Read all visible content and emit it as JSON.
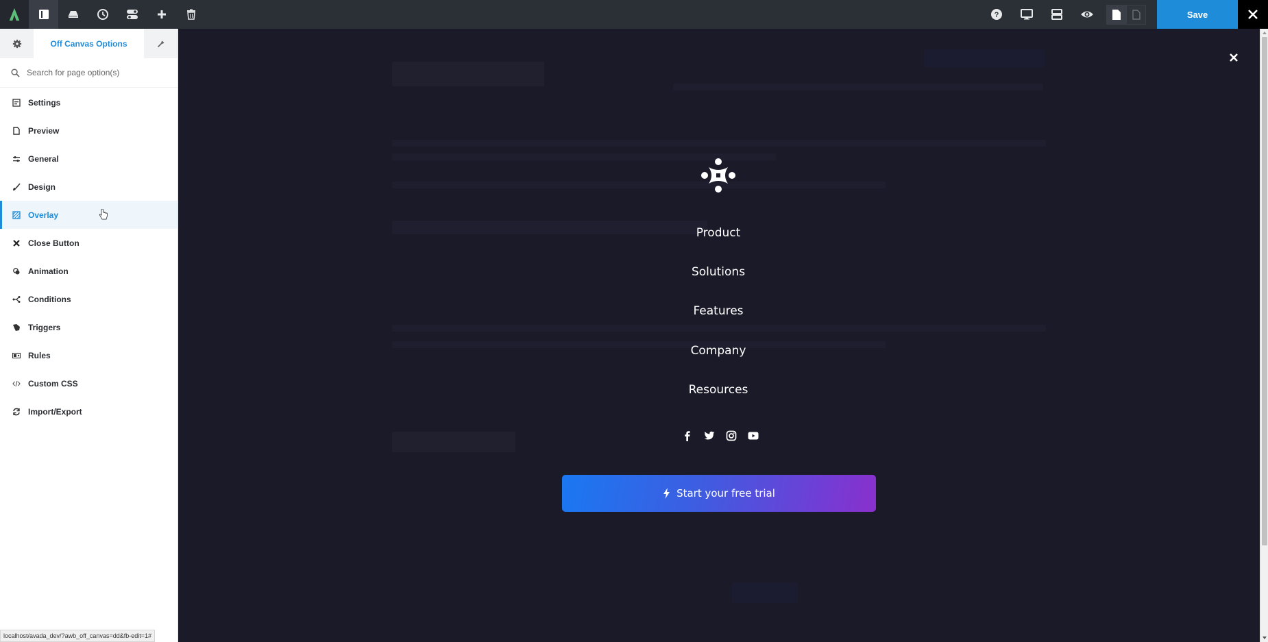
{
  "toolbar": {
    "left_buttons": [
      {
        "name": "toggle-sidebar",
        "icon": "sidebar-icon"
      },
      {
        "name": "library",
        "icon": "drive-icon"
      },
      {
        "name": "history",
        "icon": "clock-icon"
      },
      {
        "name": "layout",
        "icon": "toggles-icon"
      },
      {
        "name": "add",
        "icon": "plus-icon"
      },
      {
        "name": "delete",
        "icon": "trash-icon"
      }
    ],
    "right_buttons": [
      {
        "name": "help",
        "icon": "help-icon"
      },
      {
        "name": "desktop-preview",
        "icon": "monitor-icon"
      },
      {
        "name": "wireframe",
        "icon": "rows-icon"
      },
      {
        "name": "preview",
        "icon": "eye-icon"
      }
    ],
    "save_label": "Save",
    "brand_color": "#1e8cd9",
    "logo_color": "#5cc07a"
  },
  "sidebar": {
    "title": "Off Canvas Options",
    "search_placeholder": "Search for page option(s)",
    "items": [
      {
        "label": "Settings",
        "icon": "settings-panel-icon",
        "active": false
      },
      {
        "label": "Preview",
        "icon": "document-icon",
        "active": false
      },
      {
        "label": "General",
        "icon": "sliders-icon",
        "active": false
      },
      {
        "label": "Design",
        "icon": "brush-icon",
        "active": false
      },
      {
        "label": "Overlay",
        "icon": "overlay-icon",
        "active": true
      },
      {
        "label": "Close Button",
        "icon": "close-icon",
        "active": false
      },
      {
        "label": "Animation",
        "icon": "animation-icon",
        "active": false
      },
      {
        "label": "Conditions",
        "icon": "conditions-icon",
        "active": false
      },
      {
        "label": "Triggers",
        "icon": "triggers-icon",
        "active": false
      },
      {
        "label": "Rules",
        "icon": "rules-icon",
        "active": false
      },
      {
        "label": "Custom CSS",
        "icon": "code-icon",
        "active": false
      },
      {
        "label": "Import/Export",
        "icon": "sync-icon",
        "active": false
      }
    ]
  },
  "status_url": "localhost/avada_dev/?awb_off_canvas=dd&fb-edit=1#",
  "off_canvas": {
    "menu": [
      "Product",
      "Solutions",
      "Features",
      "Company",
      "Resources"
    ],
    "social": [
      "facebook-icon",
      "twitter-icon",
      "instagram-icon",
      "youtube-icon"
    ],
    "cta_label": "Start your free trial",
    "background_color": "#1a1a28",
    "cta_gradient": [
      "#1a78f2",
      "#8a30cc"
    ]
  }
}
